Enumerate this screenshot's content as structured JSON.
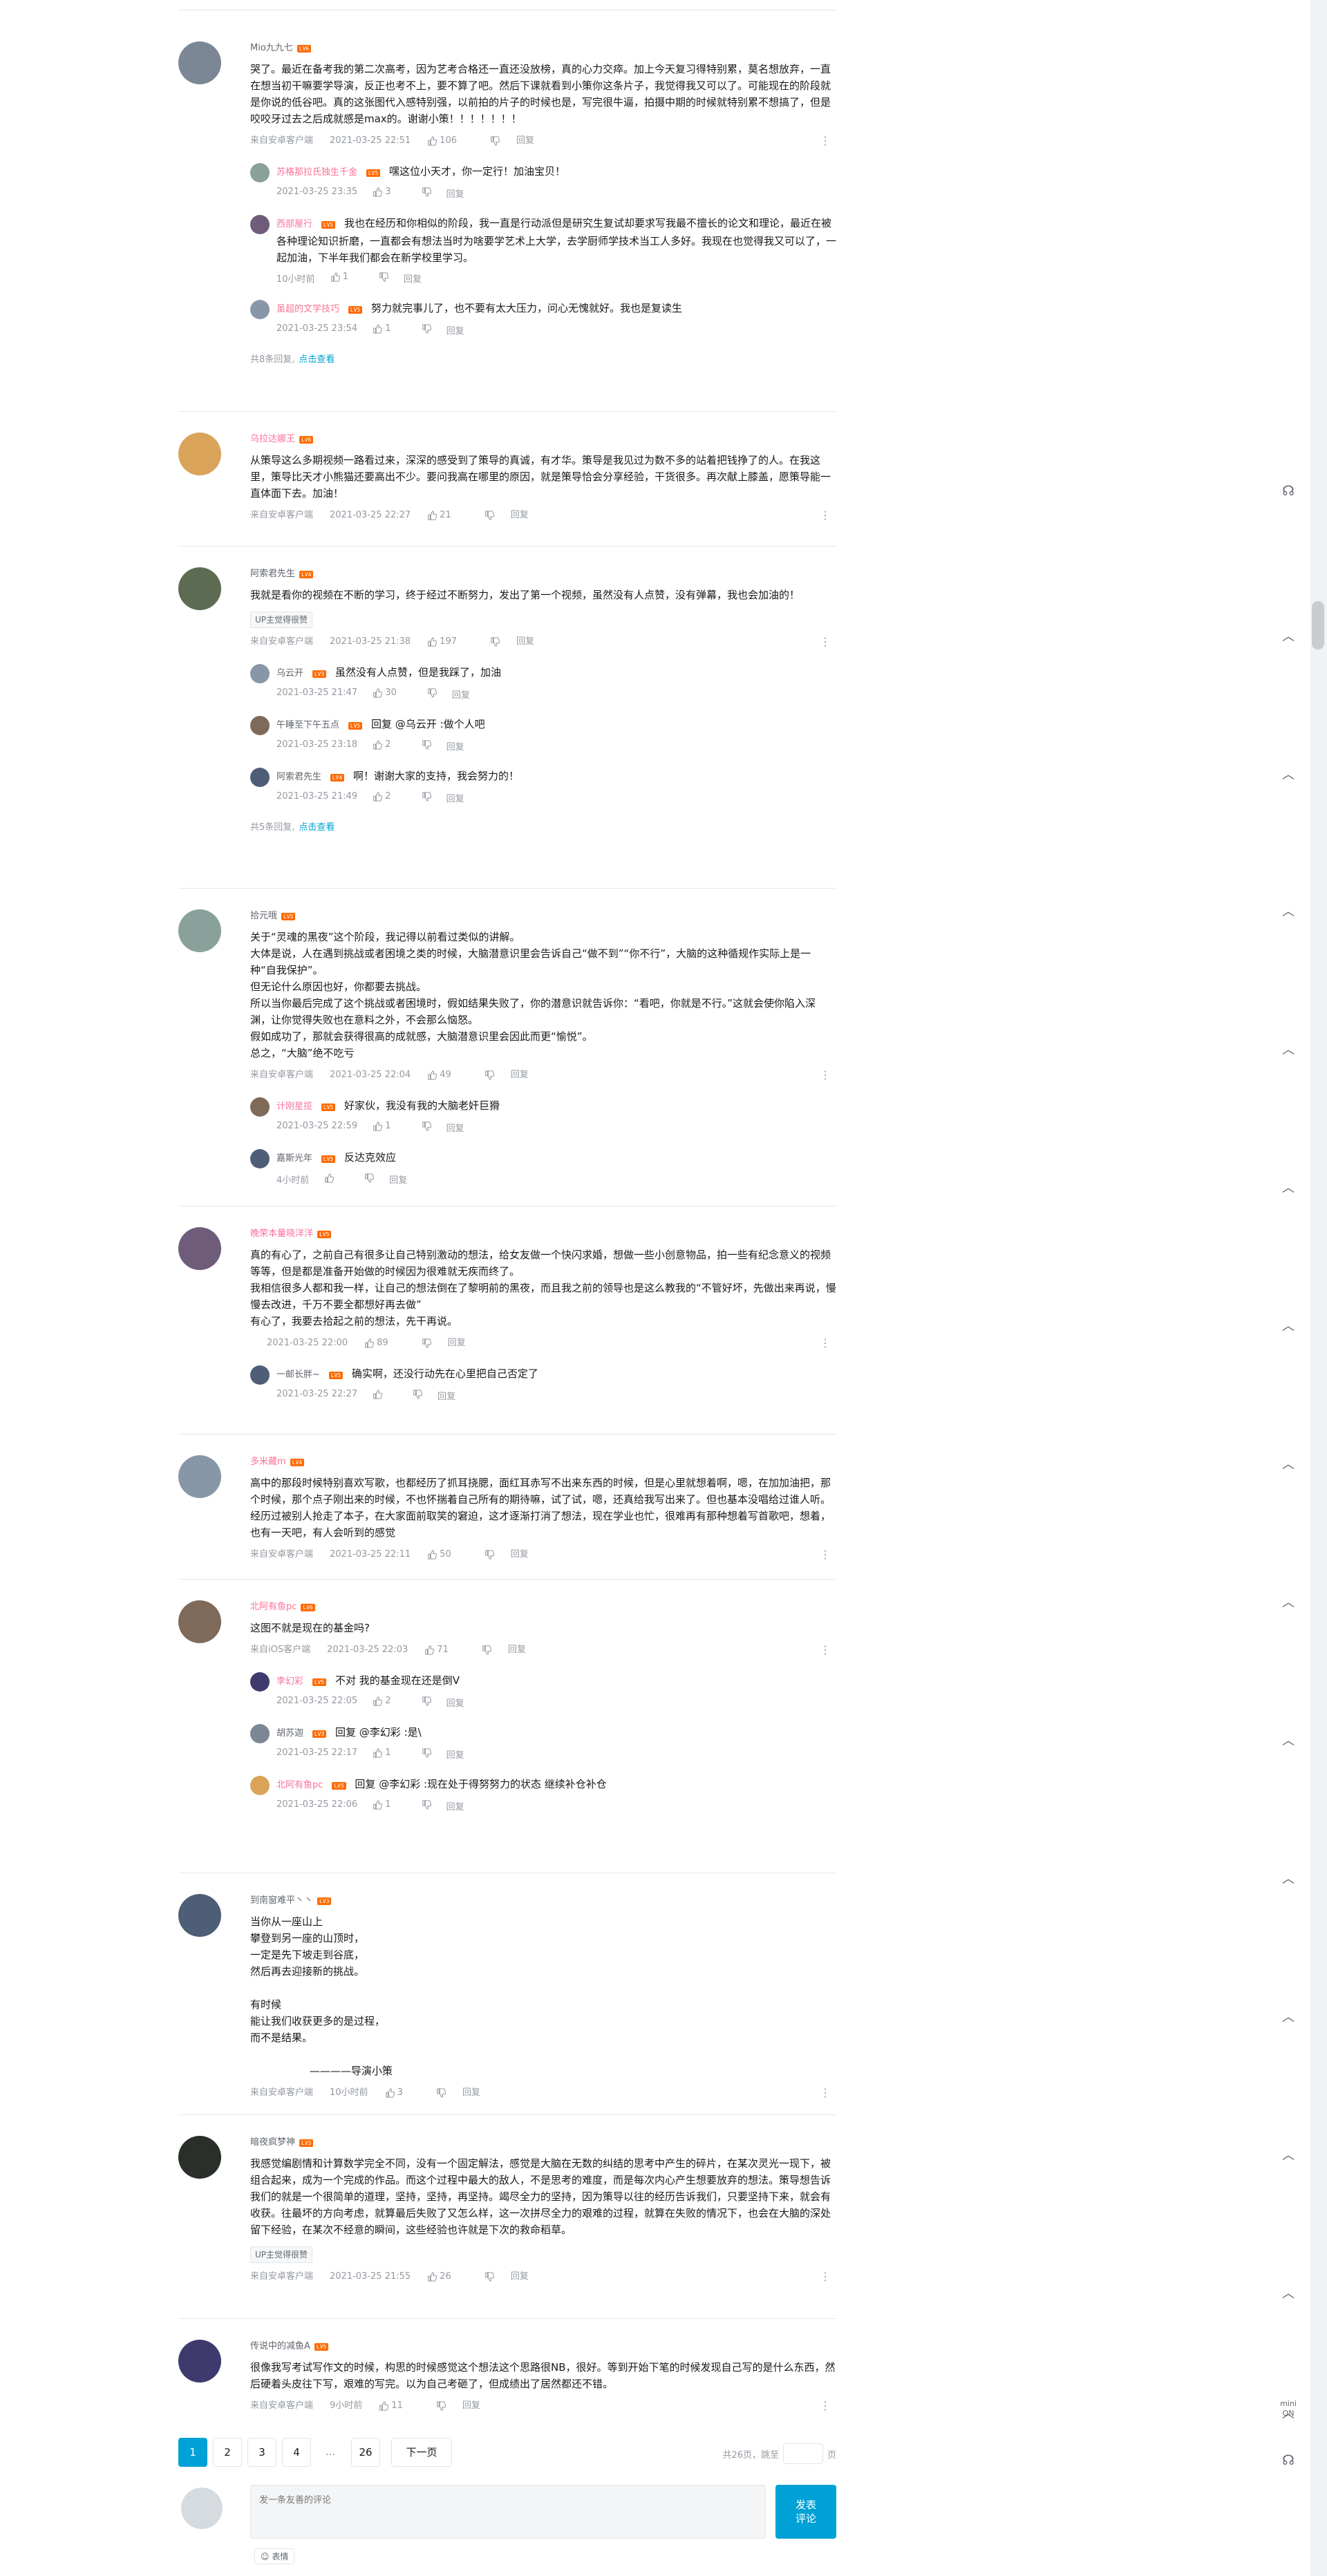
{
  "comments": [
    {
      "name": "Mio九九七",
      "name_pink": false,
      "level": "LV6",
      "text": "哭了。最近在备考我的第二次高考，因为艺考合格还一直还没放榜，真的心力交瘁。加上今天复习得特别累，莫名想放弃，一直在想当初干嘛要学导演，反正也考不上，要不算了吧。然后下课就看到小策你这条片子，我觉得我又可以了。可能现在的阶段就是你说的低谷吧。真的这张图代入感特别强，以前拍的片子的时候也是，写完很牛逼，拍摄中期的时候就特别累不想搞了，但是咬咬牙过去之后成就感是max的。谢谢小策！！！！！！！",
      "device": "来自安卓客户端",
      "time": "2021-03-25 22:51",
      "likes": "106",
      "reply": "回复",
      "subs": [
        {
          "name": "苏格那拉氏独生千金",
          "pink": true,
          "level": "LV5",
          "text": "嘿这位小天才，你一定行！加油宝贝！",
          "time": "2021-03-25 23:35",
          "likes": "3",
          "reply": "回复"
        },
        {
          "name": "西部屋行",
          "pink": true,
          "level": "LV5",
          "text": "我也在经历和你相似的阶段，我一直是行动派但是研究生复试却要求写我最不擅长的论文和理论，最近在被各种理论知识折磨，一直都会有想法当时为啥要学艺术上大学，去学厨师学技术当工人多好。我现在也觉得我又可以了，一起加油，下半年我们都会在新学校里学习。",
          "time": "10小时前",
          "likes": "1",
          "reply": "回复"
        },
        {
          "name": "虽超的文学技巧",
          "pink": true,
          "level": "LV5",
          "text": "努力就完事儿了，也不要有太大压力，问心无愧就好。我也是复读生",
          "time": "2021-03-25 23:54",
          "likes": "1",
          "reply": "回复"
        }
      ],
      "more": "共8条回复,",
      "more_link": "点击查看"
    },
    {
      "name": "乌拉达娜王",
      "name_pink": true,
      "level": "LV6",
      "text": "从策导这么多期视频一路看过来，深深的感受到了策导的真诚，有才华。策导是我见过为数不多的站着把钱挣了的人。在我这里，策导比天才小熊猫还要高出不少。要问我高在哪里的原因，就是策导恰会分享经验，干货很多。再次献上膝盖，愿策导能一直体面下去。加油！",
      "device": "来自安卓客户端",
      "time": "2021-03-25 22:27",
      "likes": "21",
      "reply": "回复",
      "subs": [],
      "more": "",
      "more_link": ""
    },
    {
      "name": "阿索君先生",
      "name_pink": false,
      "level": "LV4",
      "text": "我就是看你的视频在不断的学习，终于经过不断努力，发出了第一个视频，虽然没有人点赞，没有弹幕，我也会加油的！",
      "device": "来自安卓客户端",
      "time": "2021-03-25 21:38",
      "likes": "197",
      "reply": "回复",
      "up_tag": "UP主觉得很赞",
      "subs": [
        {
          "name": "乌云开",
          "pink": false,
          "level": "LV3",
          "text": "虽然没有人点赞，但是我踩了，加油",
          "time": "2021-03-25 21:47",
          "likes": "30",
          "reply": "回复"
        },
        {
          "name": "午睡至下午五点",
          "pink": false,
          "level": "LV5",
          "text": "回复 @乌云开 :做个人吧",
          "time": "2021-03-25 23:18",
          "likes": "2",
          "reply": "回复"
        },
        {
          "name": "阿索君先生",
          "pink": false,
          "level": "LV4",
          "text": "啊！谢谢大家的支持，我会努力的！",
          "time": "2021-03-25 21:49",
          "likes": "2",
          "reply": "回复"
        }
      ],
      "more": "共5条回复,",
      "more_link": "点击查看"
    },
    {
      "name": "拾元哦",
      "name_pink": false,
      "level": "LV5",
      "text": "关于“灵魂的黑夜”这个阶段，我记得以前看过类似的讲解。\n大体是说，人在遇到挑战或者困境之类的时候，大脑潜意识里会告诉自己“做不到”“你不行”，大脑的这种循规作实际上是一种“自我保护”。\n但无论什么原因也好，你都要去挑战。\n所以当你最后完成了这个挑战或者困境时，假如结果失败了，你的潜意识就告诉你：“看吧，你就是不行。”这就会使你陷入深渊，让你觉得失败也在意料之外，不会那么恼怒。\n假如成功了，那就会获得很高的成就感，大脑潜意识里会因此而更“愉悦”。\n总之，“大脑”绝不吃亏",
      "device": "来自安卓客户端",
      "time": "2021-03-25 22:04",
      "likes": "49",
      "reply": "回复",
      "subs": [
        {
          "name": "计刚星揽",
          "pink": true,
          "level": "LV5",
          "text": "好家伙，我没有我的大脑老奸巨猾",
          "time": "2021-03-25 22:59",
          "likes": "1",
          "reply": "回复"
        },
        {
          "name": "嘉斯光年",
          "pink": false,
          "level": "LV5",
          "text": "反达克效应",
          "time": "4小时前",
          "likes": "",
          "reply": "回复"
        }
      ],
      "more": "",
      "more_link": ""
    },
    {
      "name": "晚荣本量晓洋洋",
      "name_pink": true,
      "level": "LV5",
      "text": "真的有心了，之前自己有很多让自己特别激动的想法，给女友做一个快闪求婚，想做一些小创意物品，拍一些有纪念意义的视频等等，但是都是准备开始做的时候因为很难就无疾而终了。\n我相信很多人都和我一样，让自己的想法倒在了黎明前的黑夜，而且我之前的领导也是这么教我的“不管好坏，先做出来再说，慢慢去改进，千万不要全都想好再去做”\n有心了，我要去拾起之前的想法，先干再说。",
      "device": "",
      "time": "2021-03-25 22:00",
      "likes": "89",
      "reply": "回复",
      "subs": [
        {
          "name": "一邮长胖~",
          "pink": false,
          "level": "LV5",
          "text": "确实啊，还没行动先在心里把自己否定了",
          "time": "2021-03-25 22:27",
          "likes": "",
          "reply": "回复"
        }
      ],
      "more": "",
      "more_link": ""
    },
    {
      "name": "多米藏m",
      "name_pink": true,
      "level": "LV4",
      "text": "高中的那段时候特别喜欢写歌，也都经历了抓耳挠腮，面红耳赤写不出来东西的时候，但是心里就想着啊，嗯，在加加油把，那个时候，那个点子刚出来的时候，不也怀揣着自己所有的期待嘛，试了试，嗯，还真给我写出来了。但也基本没唱给过谁人听。经历过被别人抢走了本子，在大家面前取笑的窘迫，这才逐渐打消了想法，现在学业也忙，很难再有那种想着写首歌吧，想着，也有一天吧，有人会听到的感觉",
      "device": "来自安卓客户端",
      "time": "2021-03-25 22:11",
      "likes": "50",
      "reply": "回复",
      "subs": [],
      "more": "",
      "more_link": ""
    },
    {
      "name": "北阿有鱼pc",
      "name_pink": true,
      "level": "LV6",
      "text": "这图不就是现在的基金吗?",
      "device": "来自iOS客户端",
      "time": "2021-03-25 22:03",
      "likes": "71",
      "reply": "回复",
      "subs": [
        {
          "name": "李幻彩",
          "pink": true,
          "level": "LV5",
          "text": "不对 我的基金现在还是倒V",
          "time": "2021-03-25 22:05",
          "likes": "2",
          "reply": "回复"
        },
        {
          "name": "胡苏迦",
          "pink": false,
          "level": "LV3",
          "text": "回复 @李幻彩 :是\\",
          "time": "2021-03-25 22:17",
          "likes": "1",
          "reply": "回复"
        },
        {
          "name": "北阿有鱼pc",
          "pink": true,
          "level": "LV5",
          "text": "回复 @李幻彩 :现在处于得努努力的状态 继续补仓补仓",
          "time": "2021-03-25 22:06",
          "likes": "1",
          "reply": "回复"
        }
      ],
      "more": "",
      "more_link": ""
    },
    {
      "name": "到南窗难平丶丶",
      "name_pink": false,
      "level": "LV3",
      "text": "当你从一座山上\n攀登到另一座的山顶时，\n一定是先下坡走到谷底，\n然后再去迎接新的挑战。\n\n有时候\n能让我们收获更多的是过程，\n而不是结果。\n\n                  ————导演小策",
      "device": "来自安卓客户端",
      "time": "10小时前",
      "likes": "3",
      "reply": "回复",
      "subs": [],
      "more": "",
      "more_link": ""
    },
    {
      "name": "暗夜疯梦神",
      "name_pink": false,
      "level": "LV5",
      "text": "我感觉编剧情和计算数学完全不同，没有一个固定解法，感觉是大脑在无数的纠结的思考中产生的碎片，在某次灵光一现下，被组合起来，成为一个完成的作品。而这个过程中最大的敌人，不是思考的难度，而是每次内心产生想要放弃的想法。策导想告诉我们的就是一个很简单的道理，坚持，坚持，再坚持。竭尽全力的坚持，因为策导以往的经历告诉我们，只要坚持下来，就会有收获。往最坏的方向考虑，就算最后失败了又怎么样，这一次拼尽全力的艰难的过程，就算在失败的情况下，也会在大脑的深处留下经验，在某次不经意的瞬间，这些经验也许就是下次的救命稻草。",
      "device": "来自安卓客户端",
      "time": "2021-03-25 21:55",
      "likes": "26",
      "reply": "回复",
      "up_tag": "UP主觉得很赞",
      "subs": [],
      "more": "",
      "more_link": ""
    },
    {
      "name": "传说中的减鱼A",
      "name_pink": false,
      "level": "LV5",
      "text": "很像我写考试写作文的时候，构思的时候感觉这个想法这个思路很NB，很好。等到开始下笔的时候发现自己写的是什么东西，然后硬着头皮往下写，艰难的写完。以为自己考砸了，但成绩出了居然都还不错。",
      "device": "来自安卓客户端",
      "time": "9小时前",
      "likes": "11",
      "reply": "回复",
      "subs": [],
      "more": "",
      "more_link": ""
    }
  ],
  "pagination": {
    "pages": [
      "1",
      "2",
      "3",
      "4"
    ],
    "ellipsis": "...",
    "last": "26",
    "next": "下一页",
    "total_label": "共26页，跳至",
    "page_unit": "页"
  },
  "composer": {
    "placeholder": "发一条友善的评论",
    "send": "发表\n评论",
    "emoji": "表情"
  },
  "side": {
    "mini": "mini\nON"
  }
}
